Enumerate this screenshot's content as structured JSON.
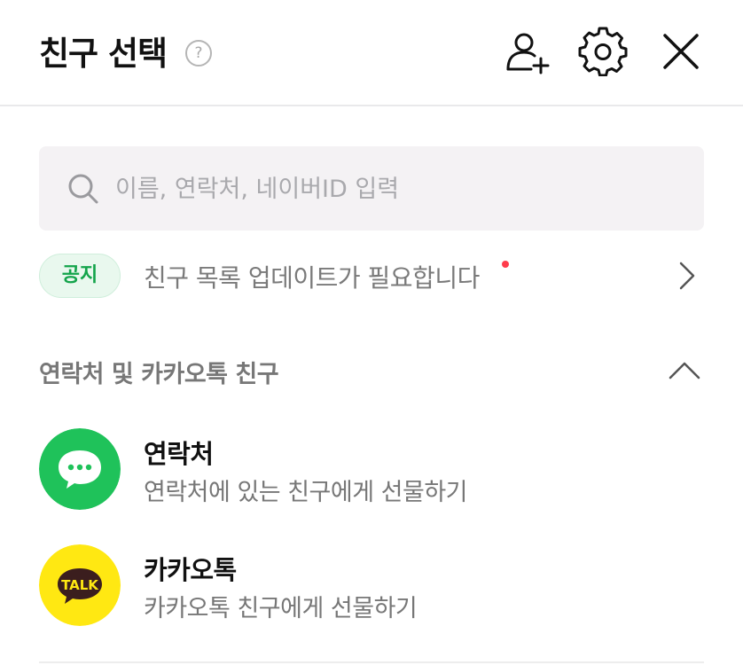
{
  "header": {
    "title": "친구 선택",
    "help_symbol": "?",
    "icons": [
      "add-friend-icon",
      "settings-gear-icon",
      "close-icon"
    ]
  },
  "search": {
    "placeholder": "이름, 연락처, 네이버ID 입력",
    "value": ""
  },
  "notice": {
    "badge": "공지",
    "text": "친구 목록 업데이트가 필요합니다",
    "has_unread_dot": true,
    "badge_color": "#14a44b",
    "dot_color": "#ff3c4c"
  },
  "section": {
    "title": "연락처 및 카카오톡 친구",
    "expanded": true
  },
  "items": [
    {
      "name": "연락처",
      "description": "연락처에 있는 친구에게 선물하기",
      "icon": "message-bubble-icon",
      "icon_color": "#1fc25a"
    },
    {
      "name": "카카오톡",
      "description": "카카오톡 친구에게 선물하기",
      "icon": "kakao-talk-icon",
      "icon_text": "TALK",
      "icon_color": "#ffe812"
    }
  ]
}
